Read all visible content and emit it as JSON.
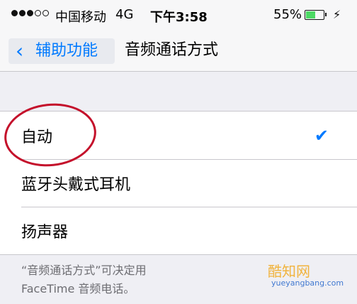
{
  "status_bar": {
    "carrier": "中国移动",
    "network": "4G",
    "time": "下午3:58",
    "battery_percent": "55%",
    "battery_level": 0.55,
    "signal_dots_filled": 3,
    "signal_dots_empty": 2
  },
  "nav": {
    "back_label": "辅助功能",
    "title": "音频通话方式"
  },
  "options": [
    {
      "label": "自动",
      "selected": true
    },
    {
      "label": "蓝牙头戴式耳机",
      "selected": false
    },
    {
      "label": "扬声器",
      "selected": false
    }
  ],
  "footer": {
    "line1": "“音频通话方式”可决定用",
    "line2": "FaceTime 音频电话。"
  },
  "watermark": {
    "text": "酷知网",
    "site": "yueyangbang.com"
  },
  "colors": {
    "accent": "#007aff",
    "annotation": "#c4102b",
    "battery": "#4cd964",
    "background": "#efeff4"
  }
}
